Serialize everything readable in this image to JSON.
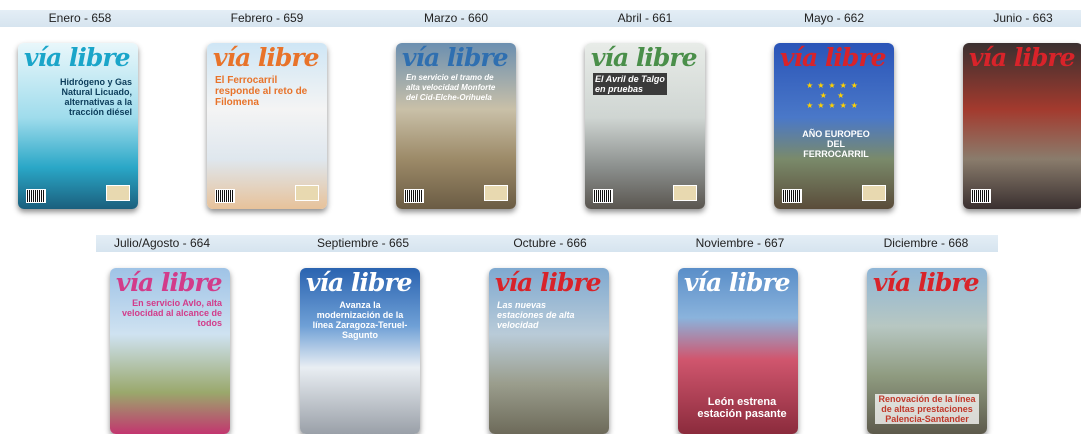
{
  "issues": [
    {
      "label": "Enero - 658",
      "headline": "Hidrógeno y Gas Natural Licuado, alternativas a la tracción diésel",
      "accent": "#1aa5c9"
    },
    {
      "label": "Febrero - 659",
      "headline": "El Ferrocarril responde al reto de Filomena",
      "accent": "#e8732a"
    },
    {
      "label": "Marzo - 660",
      "headline": "En servicio el tramo de alta velocidad Monforte del Cid-Elche-Orihuela",
      "accent": "#2f6fb0"
    },
    {
      "label": "Abril - 661",
      "headline": "El Avril de Talgo en pruebas",
      "accent": "#4a8f4a"
    },
    {
      "label": "Mayo - 662",
      "headline": "AÑO EUROPEO DEL FERROCARRIL",
      "accent": "#1f3f9a"
    },
    {
      "label": "Junio - 663",
      "headline": "",
      "accent": "#c0392b"
    },
    {
      "label": "Julio/Agosto - 664",
      "headline": "En servicio Avlo, alta velocidad al alcance de todos",
      "accent": "#d23c8a"
    },
    {
      "label": "Septiembre - 665",
      "headline": "Avanza la modernización de la línea Zaragoza-Teruel-Sagunto",
      "accent": "#2f7dc0"
    },
    {
      "label": "Octubre - 666",
      "headline": "Las nuevas estaciones de alta velocidad",
      "accent": "#5a8ab0"
    },
    {
      "label": "Noviembre - 667",
      "headline": "León estrena estación pasante",
      "accent": "#b03060"
    },
    {
      "label": "Diciembre - 668",
      "headline": "Renovación de la línea de altas prestaciones Palencia-Santander",
      "accent": "#c0392b"
    }
  ],
  "masthead": "vía libre"
}
